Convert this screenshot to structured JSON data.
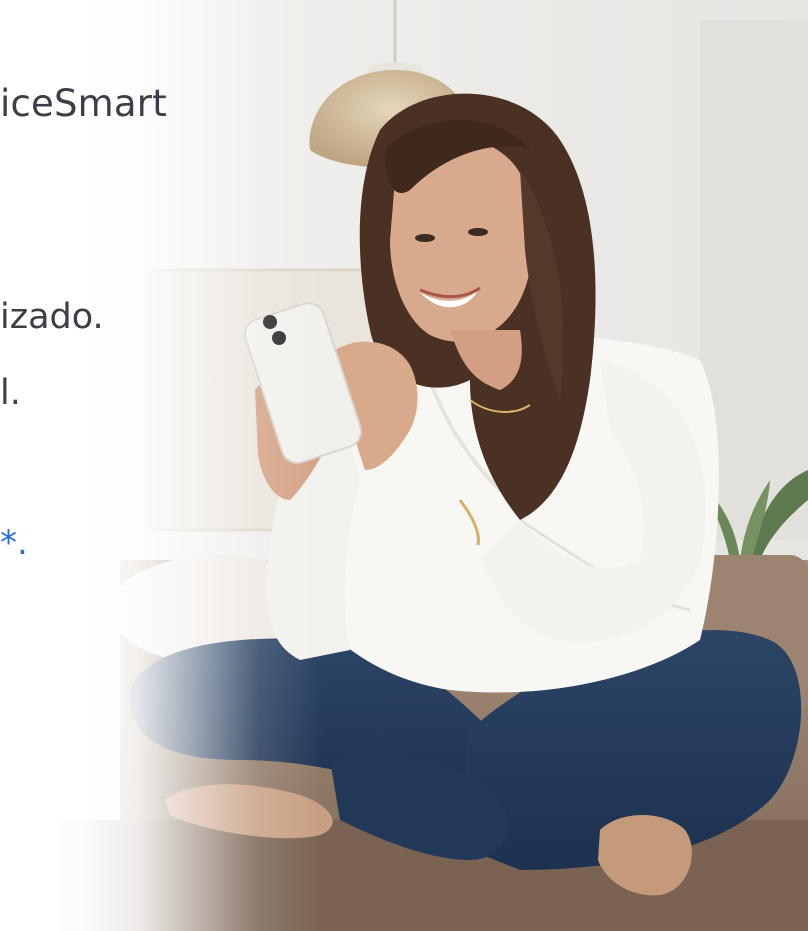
{
  "brand_text": "iceSmart",
  "line_1": "izado.",
  "line_2": "l.",
  "footnote_mark": "*."
}
